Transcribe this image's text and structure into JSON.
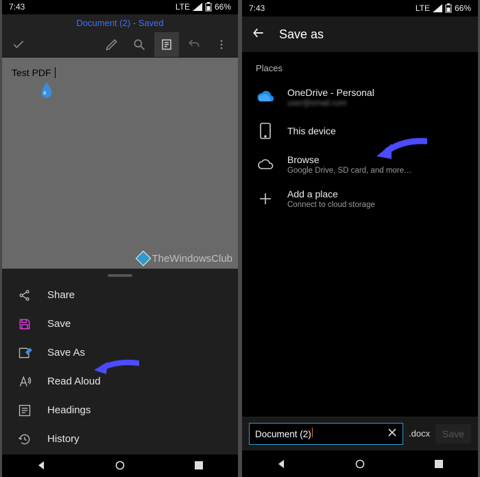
{
  "left": {
    "status": {
      "time": "7:43",
      "network": "LTE",
      "battery_text": "66%"
    },
    "doc_title": "Document (2) - Saved",
    "canvas_text": "Test PDF",
    "watermark": "TheWindowsClub",
    "menu": {
      "share": "Share",
      "save": "Save",
      "save_as": "Save As",
      "read_aloud": "Read Aloud",
      "headings": "Headings",
      "history": "History"
    }
  },
  "right": {
    "status": {
      "time": "7:43",
      "network": "LTE",
      "battery_text": "66%"
    },
    "header_title": "Save as",
    "places_label": "Places",
    "places": {
      "onedrive": {
        "title": "OneDrive - Personal",
        "sub": "user@email.com"
      },
      "device": {
        "title": "This device"
      },
      "browse": {
        "title": "Browse",
        "sub": "Google Drive, SD card, and more…"
      },
      "add": {
        "title": "Add a place",
        "sub": "Connect to cloud storage"
      }
    },
    "filename": "Document (2)",
    "extension": ".docx",
    "save_button": "Save"
  }
}
